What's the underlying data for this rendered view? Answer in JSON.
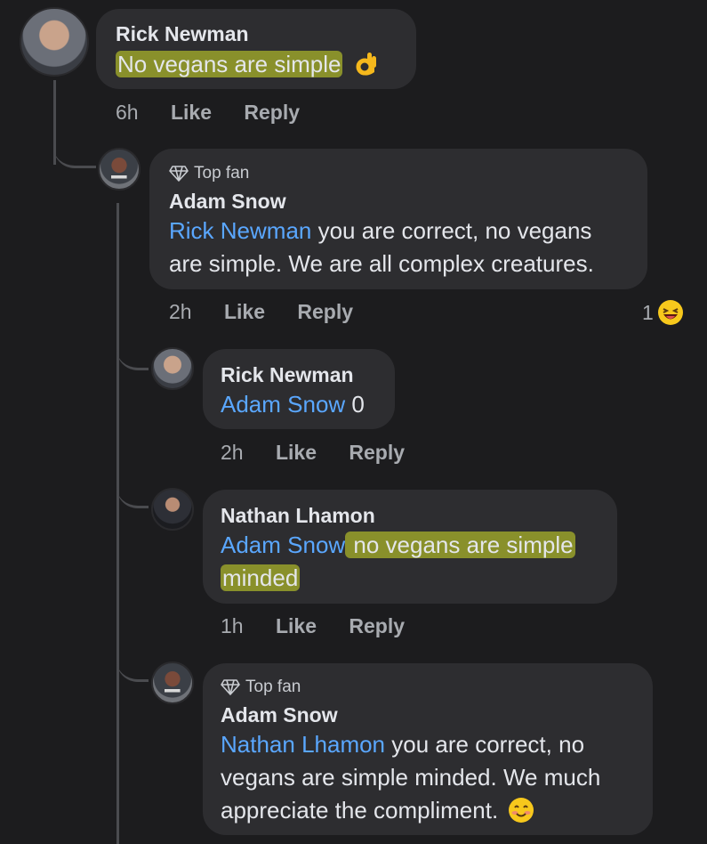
{
  "comments": [
    {
      "author": "Rick Newman",
      "text": "No vegans are simple",
      "emoji": "ok-hand",
      "time": "6h",
      "like": "Like",
      "reply": "Reply"
    },
    {
      "badge": "Top fan",
      "author": "Adam Snow",
      "mention": "Rick Newman",
      "text_line1": " you are correct, no vegans",
      "text_line2": "are simple. We are all complex creatures.",
      "time": "2h",
      "like": "Like",
      "reply": "Reply",
      "reaction_count": "1"
    },
    {
      "author": "Rick Newman",
      "mention": "Adam Snow",
      "text": " 0",
      "time": "2h",
      "like": "Like",
      "reply": "Reply"
    },
    {
      "author": "Nathan Lhamon",
      "mention": "Adam Snow",
      "text_line1": " no vegans are simple",
      "text_line2": "minded",
      "time": "1h",
      "like": "Like",
      "reply": "Reply"
    },
    {
      "badge": "Top fan",
      "author": "Adam Snow",
      "mention": "Nathan Lhamon",
      "text_line1": " you are correct, no",
      "text_line2": "vegans are simple minded. We much",
      "text_line3": "appreciate the compliment.",
      "emoji": "smiling-face"
    }
  ]
}
